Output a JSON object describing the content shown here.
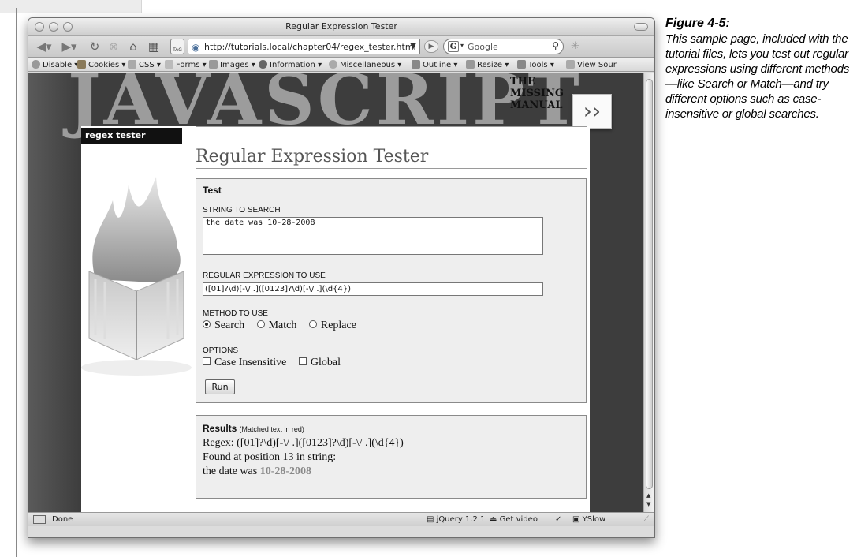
{
  "window": {
    "title": "Regular Expression Tester"
  },
  "navbar": {
    "url": "http://tutorials.local/chapter04/regex_tester.html",
    "search_placeholder": "Google",
    "tag_label": "TAG"
  },
  "devbar": {
    "items": [
      {
        "label": "Disable",
        "icon": "no-entry-icon"
      },
      {
        "label": "Cookies",
        "icon": "cookie-icon"
      },
      {
        "label": "CSS",
        "icon": "css-icon"
      },
      {
        "label": "Forms",
        "icon": "form-icon"
      },
      {
        "label": "Images",
        "icon": "image-icon"
      },
      {
        "label": "Information",
        "icon": "info-icon"
      },
      {
        "label": "Miscellaneous",
        "icon": "misc-icon"
      },
      {
        "label": "Outline",
        "icon": "pencil-icon"
      },
      {
        "label": "Resize",
        "icon": "resize-icon"
      },
      {
        "label": "Tools",
        "icon": "wrench-icon"
      },
      {
        "label": "View Sour",
        "icon": "source-icon"
      }
    ]
  },
  "banner": {
    "word": "JAVASCRIPT",
    "line1": "THE",
    "line2": "MISSING",
    "line3": "MANUAL",
    "arrow": "›› "
  },
  "page": {
    "side_tab": "regex tester",
    "title": "Regular Expression Tester"
  },
  "test_box": {
    "title": "Test",
    "string_label": "STRING TO SEARCH",
    "string_value": "the date was 10-28-2008",
    "regex_label": "REGULAR EXPRESSION TO USE",
    "regex_value": "([01]?\\d)[-\\/ .]([0123]?\\d)[-\\/ .](\\d{4})",
    "method_label": "METHOD TO USE",
    "methods": [
      "Search",
      "Match",
      "Replace"
    ],
    "selected_method": "Search",
    "options_label": "OPTIONS",
    "options": [
      "Case Insensitive",
      "Global"
    ],
    "run_label": "Run"
  },
  "results": {
    "title": "Results",
    "subtitle": "(Matched text in red)",
    "regex_line": "Regex: ([01]?\\d)[-\\/ .]([0123]?\\d)[-\\/ .](\\d{4})",
    "found_line": "Found at position 13 in string:",
    "string_prefix": "the date was ",
    "matched_text": "10-28-2008"
  },
  "statusbar": {
    "status": "Done",
    "jquery": "jQuery 1.2.1",
    "video": "Get video",
    "yslow": "YSlow"
  },
  "caption": {
    "title": "Figure 4-5:",
    "text": "This sample page, included with the tutorial files, lets you test out regular expressions using different methods—like Search or Match—and try different options such as case-insensitive or global searches."
  }
}
